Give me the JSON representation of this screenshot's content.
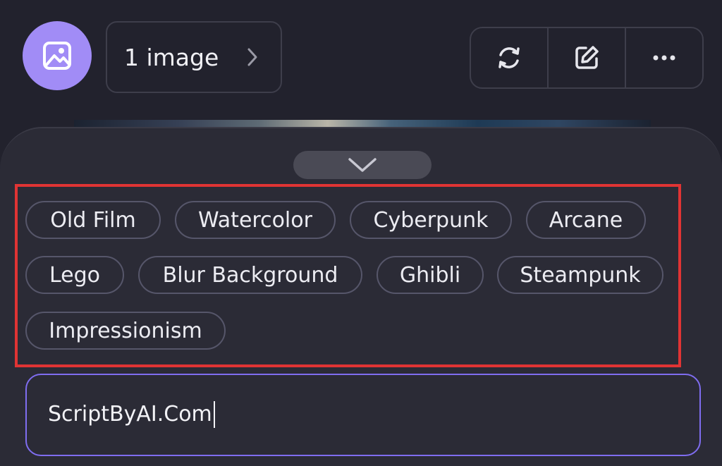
{
  "header": {
    "image_count_label": "1 image",
    "avatar_icon": "image-icon",
    "toolbar": [
      {
        "icon": "refresh-icon"
      },
      {
        "icon": "edit-icon"
      },
      {
        "icon": "more-icon"
      }
    ]
  },
  "panel": {
    "collapse_icon": "chevron-down-icon",
    "style_tags": [
      "Old Film",
      "Watercolor",
      "Cyberpunk",
      "Arcane",
      "Lego",
      "Blur Background",
      "Ghibli",
      "Steampunk",
      "Impressionism"
    ],
    "prompt_value": "ScriptByAI.Com"
  },
  "colors": {
    "background": "#22222d",
    "panel": "#2b2b36",
    "accent": "#a18cf6",
    "prompt_border": "#7f6df0",
    "highlight_box": "#e03434"
  }
}
